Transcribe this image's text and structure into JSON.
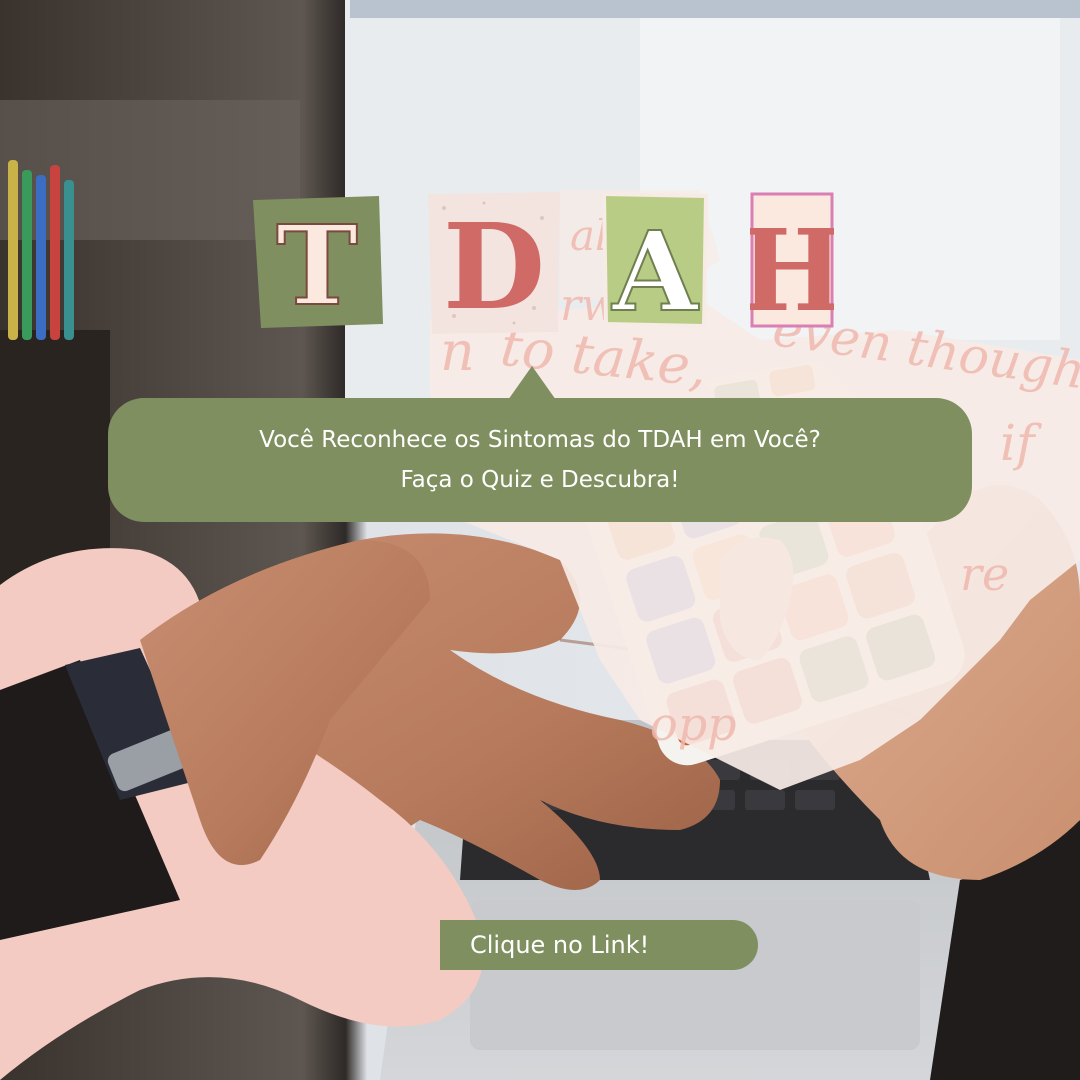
{
  "title": {
    "letters": [
      "T",
      "D",
      "A",
      "H"
    ]
  },
  "bubble": {
    "line1": "Você Reconhece os Sintomas do TDAH em Você?",
    "line2": "Faça o Quiz e Descubra!"
  },
  "cta": {
    "label": "Clique no Link!"
  },
  "background_script": {
    "words": [
      "to take,",
      "even though",
      "if",
      "re",
      "opp",
      "rwar",
      "ally"
    ]
  },
  "colors": {
    "olive": "#7f8f5f",
    "pink": "#f3cbc3",
    "rose": "#d06a66",
    "cream": "#fbe8df",
    "light_green": "#b9cc86"
  }
}
